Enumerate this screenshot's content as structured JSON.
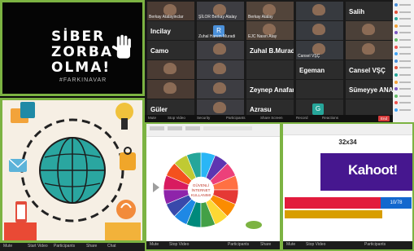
{
  "poster": {
    "line1": "SİBER",
    "line2": "ZORBA",
    "line3": "OLMA!",
    "hashtag": "#FARKINAVAR"
  },
  "left_bottom_bar": {
    "labels": [
      "Mute",
      "Start Video",
      "Participants",
      "Share",
      "Chat"
    ]
  },
  "zoom_tiles": [
    {
      "name": "Berkay Atalayinclar",
      "kind": "video"
    },
    {
      "name": "ŞİLOR Berkay Atalay",
      "kind": "video"
    },
    {
      "name": "Berkay Atalay",
      "kind": "video"
    },
    {
      "name": "",
      "kind": "video"
    },
    {
      "name": "Salih",
      "kind": "text"
    },
    {
      "name": "Incilay",
      "kind": "text"
    },
    {
      "name": "Zuhal Hanım Muradi",
      "kind": "letter",
      "letter": "R",
      "color": "#4a90d9"
    },
    {
      "name": "EJC Nasırı Atay",
      "kind": "video"
    },
    {
      "name": "",
      "kind": "video"
    },
    {
      "name": "",
      "kind": "video"
    },
    {
      "name": "Camo",
      "kind": "text"
    },
    {
      "name": "",
      "kind": "video"
    },
    {
      "name": "Zuhal B.Muradi...",
      "kind": "text"
    },
    {
      "name": "Cansel VŞÇ",
      "kind": "video"
    },
    {
      "name": "",
      "kind": "video"
    },
    {
      "name": "",
      "kind": "video"
    },
    {
      "name": "",
      "kind": "video"
    },
    {
      "name": "",
      "kind": "text"
    },
    {
      "name": "Egeman",
      "kind": "text"
    },
    {
      "name": "Cansel VŞÇ",
      "kind": "text"
    },
    {
      "name": "",
      "kind": "video"
    },
    {
      "name": "",
      "kind": "video"
    },
    {
      "name": "Zeynep Anafart...",
      "kind": "text"
    },
    {
      "name": "",
      "kind": "text"
    },
    {
      "name": "Sümeyye ANAF...",
      "kind": "text"
    },
    {
      "name": "Güler",
      "kind": "text"
    },
    {
      "name": "",
      "kind": "video"
    },
    {
      "name": "Azrasu",
      "kind": "text"
    },
    {
      "name": "",
      "kind": "letter",
      "letter": "G",
      "color": "#26a69a"
    },
    {
      "name": "",
      "kind": "text"
    }
  ],
  "zoom_bar": {
    "labels": [
      "Mute",
      "Stop Video",
      "Security",
      "Participants",
      "Share Screen",
      "Record",
      "Reactions"
    ],
    "end": "End"
  },
  "mid_panel": {
    "center_title": "GÜVENLİ İNTERNET KULLANIMI",
    "bottom_labels": [
      "Mute",
      "Stop Video",
      "Participants",
      "Share"
    ]
  },
  "kahoot": {
    "score": "32x34",
    "logo": "Kahoot!",
    "answers_badge": "10/78",
    "bottom_labels": [
      "Mute",
      "Stop Video",
      "Participants"
    ]
  },
  "colors": {
    "frame_green": "#7cb342",
    "kahoot_purple": "#46178f",
    "kahoot_red": "#e21b3c",
    "kahoot_yellow": "#d89e00"
  }
}
